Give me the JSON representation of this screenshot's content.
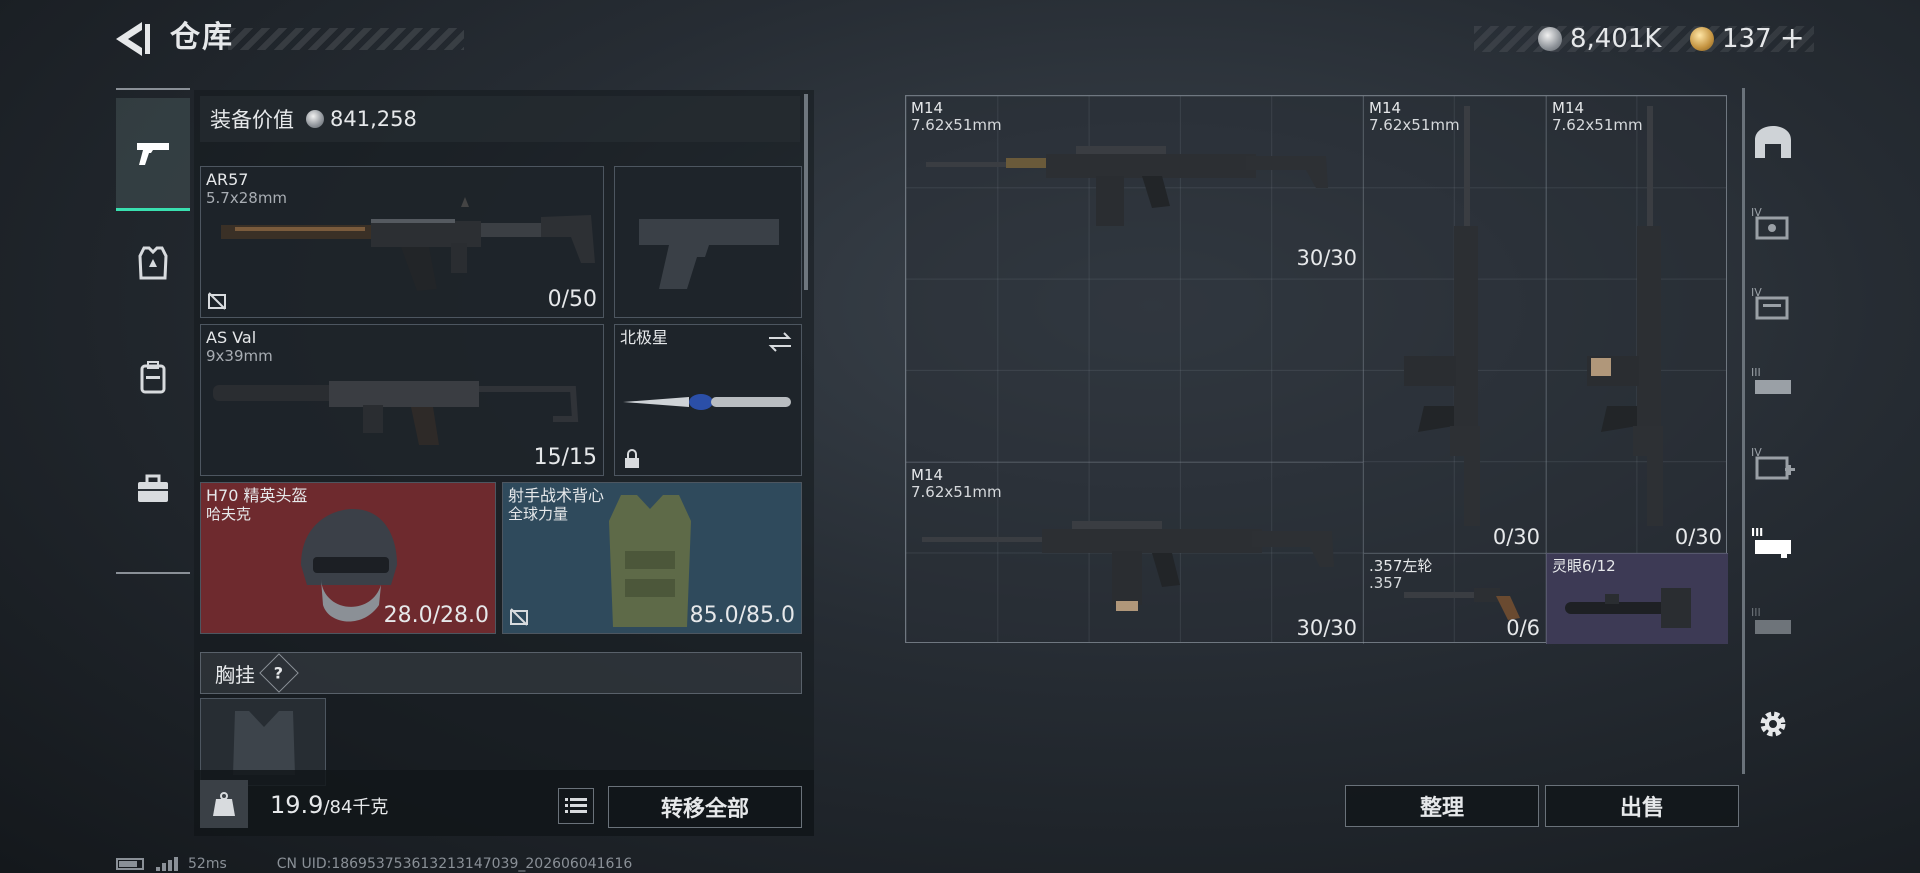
{
  "header": {
    "title": "仓库",
    "currency_main": "8,401K",
    "currency_premium": "137",
    "add_symbol": "+"
  },
  "loadout": {
    "value_label": "装备价值",
    "value": "841,258",
    "slots": {
      "primary": {
        "name": "AR57",
        "caliber": "5.7x28mm",
        "ammo": "0/50"
      },
      "secondary": {
        "name": "AS Val",
        "caliber": "9x39mm",
        "ammo": "15/15"
      },
      "melee": {
        "name": "北极星"
      },
      "helmet": {
        "name": "H70 精英头盔",
        "brand": "哈夫克",
        "durability": "28.0/28.0"
      },
      "armor": {
        "name": "射手战术背心",
        "brand": "全球力量",
        "durability": "85.0/85.0"
      },
      "chest_rig": {
        "label": "胸挂",
        "help": "?"
      }
    },
    "weight": {
      "current": "19.9",
      "max": "/84千克"
    },
    "transfer_all_label": "转移全部"
  },
  "storage": {
    "items": [
      {
        "name": "M14",
        "caliber": "7.62x51mm",
        "ammo": "30/30"
      },
      {
        "name": "M14",
        "caliber": "7.62x51mm",
        "ammo": "0/30"
      },
      {
        "name": "M14",
        "caliber": "7.62x51mm",
        "ammo": "0/30"
      },
      {
        "name": "M14",
        "caliber": "7.62x51mm",
        "ammo": "30/30"
      },
      {
        "name": ".357左轮",
        "caliber": ".357",
        "ammo": "0/6"
      },
      {
        "name": "灵眼6/12"
      }
    ],
    "sort_label": "整理",
    "sell_label": "出售"
  },
  "status": {
    "ping": "52ms",
    "uid": "CN UID:1869537536132131470​39_202606041616"
  },
  "colors": {
    "accent": "#39e0b0",
    "helmet_bg": "#6e2a2e",
    "armor_bg": "#2f4a5c",
    "scope_bg": "#3d3a55"
  }
}
